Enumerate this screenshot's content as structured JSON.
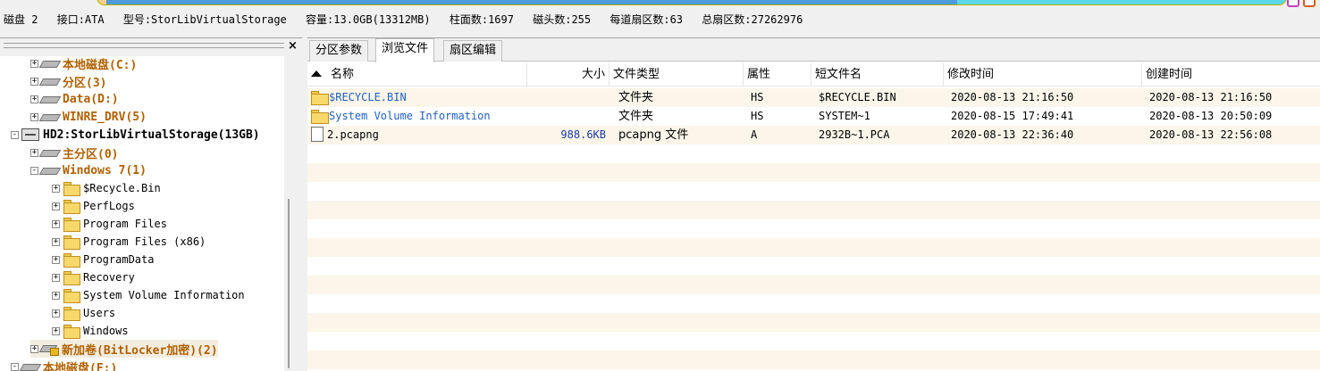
{
  "disk_info": {
    "disk": "磁盘 2",
    "interface": "接口:ATA",
    "model": "型号:StorLibVirtualStorage",
    "capacity": "容量:13.0GB(13312MB)",
    "cylinders": "柱面数:1697",
    "heads": "磁头数:255",
    "sectors_per_track": "每道扇区数:63",
    "total_sectors": "总扇区数:27262976"
  },
  "capacity_bar": {
    "used_fraction": 0.72,
    "used_color": "#4e9bdc",
    "free_color": "#59d8e8"
  },
  "left_panel": {
    "close_label": "×"
  },
  "tree": [
    {
      "label": "本地磁盘(C:)",
      "kind": "vol",
      "icon": "disk-icon"
    },
    {
      "label": "分区(3)",
      "kind": "vol",
      "icon": "disk-icon"
    },
    {
      "label": "Data(D:)",
      "kind": "vol",
      "icon": "disk-icon"
    },
    {
      "label": "WINRE_DRV(5)",
      "kind": "vol",
      "icon": "disk-icon"
    },
    {
      "label": "HD2:StorLibVirtualStorage(13GB)",
      "kind": "disk",
      "icon": "hard-drive-icon"
    },
    {
      "label": "主分区(0)",
      "kind": "vol",
      "icon": "disk-icon"
    },
    {
      "label": "Windows 7(1)",
      "kind": "vol",
      "icon": "disk-icon"
    },
    {
      "label": "$Recycle.Bin",
      "kind": "dir",
      "icon": "folder-icon"
    },
    {
      "label": "PerfLogs",
      "kind": "dir",
      "icon": "folder-icon"
    },
    {
      "label": "Program Files",
      "kind": "dir",
      "icon": "folder-icon"
    },
    {
      "label": "Program Files (x86)",
      "kind": "dir",
      "icon": "folder-icon"
    },
    {
      "label": "ProgramData",
      "kind": "dir",
      "icon": "folder-icon"
    },
    {
      "label": "Recovery",
      "kind": "dir",
      "icon": "folder-icon"
    },
    {
      "label": "System Volume Information",
      "kind": "dir",
      "icon": "folder-icon"
    },
    {
      "label": "Users",
      "kind": "dir",
      "icon": "folder-icon"
    },
    {
      "label": "Windows",
      "kind": "dir",
      "icon": "folder-icon"
    },
    {
      "label": "新加卷(BitLocker加密)(2)",
      "kind": "vol",
      "icon": "locked-disk-icon"
    },
    {
      "label": "本地磁盘(F:)",
      "kind": "vol",
      "icon": "disk-icon"
    }
  ],
  "tabs": [
    {
      "label": "分区参数"
    },
    {
      "label": "浏览文件"
    },
    {
      "label": "扇区编辑"
    }
  ],
  "columns": {
    "name": "名称",
    "size": "大小",
    "type": "文件类型",
    "attr": "属性",
    "short": "短文件名",
    "modified": "修改时间",
    "created": "创建时间"
  },
  "files": [
    {
      "name": "$RECYCLE.BIN",
      "size": "",
      "type": "文件夹",
      "attr": "HS",
      "short": "$RECYCLE.BIN",
      "modified": "2020-08-13 21:16:50",
      "created": "2020-08-13 21:16:50",
      "icon": "folder-icon"
    },
    {
      "name": "System Volume Information",
      "size": "",
      "type": "文件夹",
      "attr": "HS",
      "short": "SYSTEM~1",
      "modified": "2020-08-15 17:49:41",
      "created": "2020-08-13 20:50:09",
      "icon": "folder-icon"
    },
    {
      "name": "2.pcapng",
      "size": "988.6KB",
      "type": "pcapng 文件",
      "attr": "A",
      "short": "2932B~1.PCA",
      "modified": "2020-08-13 22:36:40",
      "created": "2020-08-13 22:56:08",
      "icon": "file-icon"
    }
  ]
}
